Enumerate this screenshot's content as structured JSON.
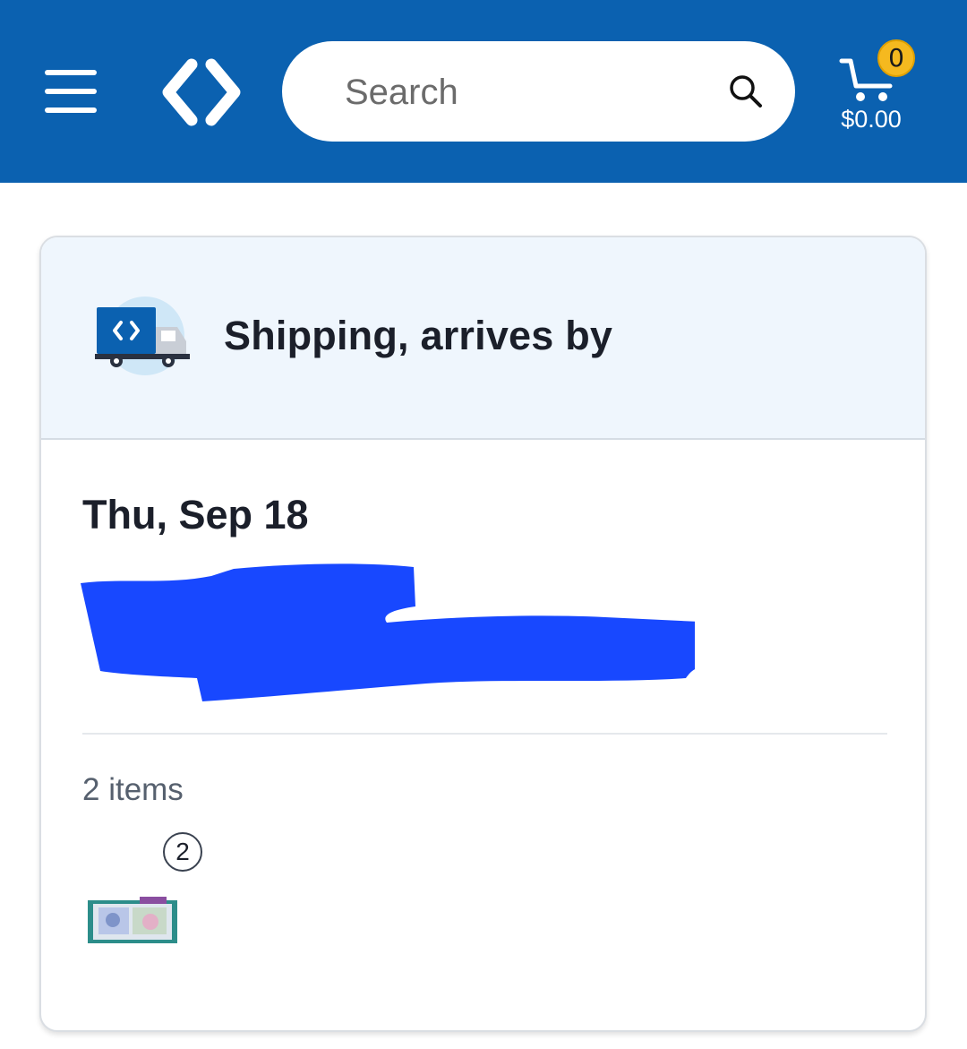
{
  "header": {
    "search_placeholder": "Search",
    "cart_count": "0",
    "cart_total": "$0.00",
    "colors": {
      "brand_blue": "#0b61b0",
      "cart_badge": "#f5b91f"
    }
  },
  "shipping": {
    "title": "Shipping, arrives by",
    "date": "Thu, Sep 18",
    "items_count": "2 items",
    "quantity": "2"
  },
  "icons": {
    "menu": "menu-icon",
    "logo": "logo-icon",
    "search": "search-icon",
    "cart": "cart-icon",
    "truck": "truck-icon"
  }
}
